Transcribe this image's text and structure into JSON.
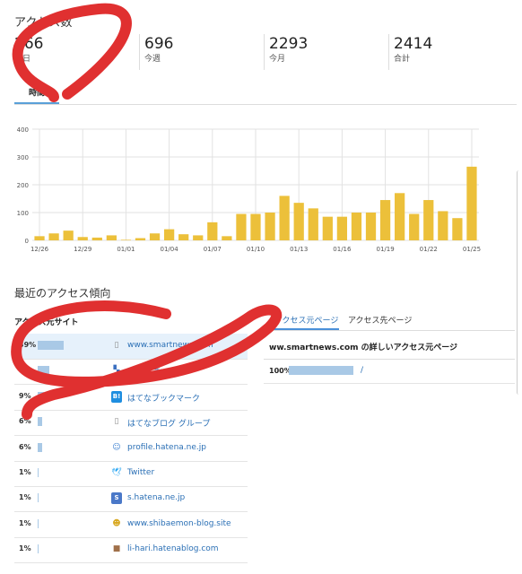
{
  "access_count": {
    "title": "アクセス数",
    "stats": [
      {
        "value": "266",
        "label": "今日"
      },
      {
        "value": "696",
        "label": "今週"
      },
      {
        "value": "2293",
        "label": "今月"
      },
      {
        "value": "2414",
        "label": "合計"
      }
    ],
    "tab_label": "時間"
  },
  "chart_data": {
    "type": "bar",
    "categories": [
      "12/26",
      "12/27",
      "12/28",
      "12/29",
      "12/30",
      "12/31",
      "01/01",
      "01/02",
      "01/03",
      "01/04",
      "01/05",
      "01/06",
      "01/07",
      "01/08",
      "01/09",
      "01/10",
      "01/11",
      "01/12",
      "01/13",
      "01/14",
      "01/15",
      "01/16",
      "01/17",
      "01/18",
      "01/19",
      "01/20",
      "01/21",
      "01/22",
      "01/23",
      "01/24",
      "01/25"
    ],
    "values": [
      15,
      25,
      35,
      12,
      10,
      18,
      2,
      8,
      25,
      40,
      22,
      18,
      65,
      15,
      95,
      95,
      100,
      160,
      135,
      115,
      85,
      85,
      100,
      100,
      145,
      170,
      95,
      145,
      105,
      80,
      265
    ],
    "tick_labels": [
      "400",
      "300",
      "200",
      "100",
      "0"
    ],
    "x_tick_labels": [
      "12/26",
      "12/29",
      "01/01",
      "01/04",
      "01/07",
      "01/10",
      "01/13",
      "01/16",
      "01/19",
      "01/22",
      "01/25"
    ],
    "ylim": [
      0,
      400
    ],
    "grid": true,
    "color": "#ecc03a"
  },
  "recent": {
    "title": "最近のアクセス傾向",
    "sites_header": "アクセス元サイト",
    "sites": [
      {
        "pct": "39%",
        "bar": 0.39,
        "name": "www.smartnews.com",
        "icon": "page-icon",
        "glyph": "▯",
        "color": "#888"
      },
      {
        "pct": "",
        "bar": 0.17,
        "name": "はてなブログ",
        "icon": "hatena-blog-icon",
        "glyph": "▚",
        "color": "#3a6fc0"
      },
      {
        "pct": "9%",
        "bar": 0.09,
        "name": "はてなブックマーク",
        "icon": "hatena-bookmark-icon",
        "glyph": "B!",
        "color": "#fff",
        "bg": "#1f8ee0"
      },
      {
        "pct": "6%",
        "bar": 0.06,
        "name": "はてなブログ グループ",
        "icon": "page-icon",
        "glyph": "▯",
        "color": "#888"
      },
      {
        "pct": "6%",
        "bar": 0.06,
        "name": "profile.hatena.ne.jp",
        "icon": "profile-icon",
        "glyph": "☺",
        "color": "#3a7fd0"
      },
      {
        "pct": "1%",
        "bar": 0.01,
        "name": "Twitter",
        "icon": "twitter-icon",
        "glyph": "🕊",
        "color": "#1da1f2"
      },
      {
        "pct": "1%",
        "bar": 0.01,
        "name": "s.hatena.ne.jp",
        "icon": "hatena-star-icon",
        "glyph": "S",
        "color": "#fff",
        "bg": "#4a78c8"
      },
      {
        "pct": "1%",
        "bar": 0.01,
        "name": "www.shibaemon-blog.site",
        "icon": "shibaemon-icon",
        "glyph": "☻",
        "color": "#d8a820"
      },
      {
        "pct": "1%",
        "bar": 0.01,
        "name": "li-hari.hatenablog.com",
        "icon": "li-hari-icon",
        "glyph": "■",
        "color": "#a0704a"
      }
    ],
    "tabs": [
      "アクセス元ページ",
      "アクセス先ページ"
    ],
    "detail_title": "ww.smartnews.com の詳しいアクセス元ページ",
    "detail_rows": [
      {
        "pct": "100%",
        "bar": 1.0,
        "path": "/"
      }
    ]
  },
  "annotations": {
    "stroke_color": "#e03030"
  }
}
